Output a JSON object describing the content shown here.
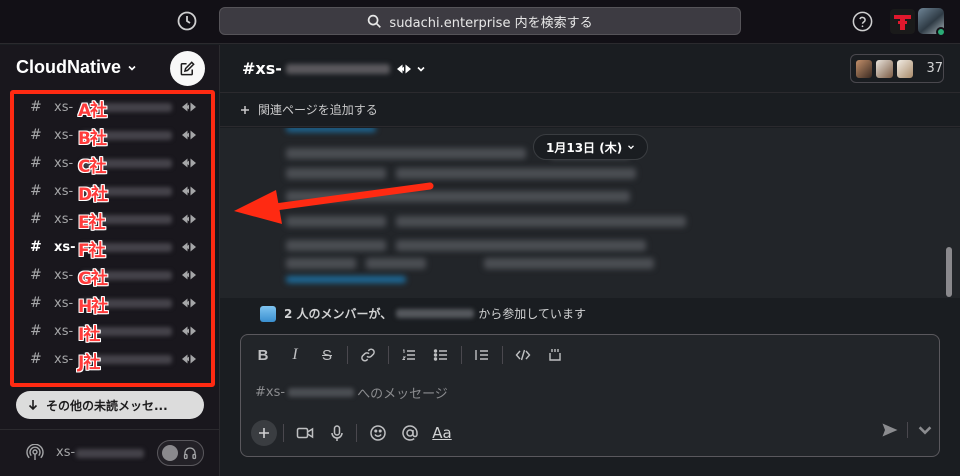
{
  "search": {
    "placeholder": "sudachi.enterprise 内を検索する"
  },
  "workspace": {
    "name": "CloudNative"
  },
  "sidebar": {
    "channels": [
      {
        "prefix": "xs-",
        "tag": "A社",
        "bold": false
      },
      {
        "prefix": "xs-",
        "tag": "B社",
        "bold": false
      },
      {
        "prefix": "xs-",
        "tag": "C社",
        "bold": false
      },
      {
        "prefix": "xs-",
        "tag": "D社",
        "bold": false
      },
      {
        "prefix": "xs-",
        "tag": "E社",
        "bold": false
      },
      {
        "prefix": "xs-",
        "tag": "F社",
        "bold": true
      },
      {
        "prefix": "xs-",
        "tag": "G社",
        "bold": false
      },
      {
        "prefix": "xs-",
        "tag": "H社",
        "bold": false
      },
      {
        "prefix": "xs-",
        "tag": "I社",
        "bold": false
      },
      {
        "prefix": "xs-",
        "tag": "J社",
        "bold": false
      }
    ],
    "unread_label": "その他の未読メッセ...",
    "huddle_prefix": "xs-"
  },
  "channel": {
    "hash": "#",
    "prefix": "xs-",
    "member_count": "37",
    "bookmark_label": "関連ページを追加する"
  },
  "messages": {
    "date_label": "1月13日 (木)"
  },
  "join": {
    "bold_text": "2 人のメンバーが、",
    "suffix": "から参加しています"
  },
  "composer": {
    "prefix": "#xs-",
    "suffix": "へのメッセージ",
    "aa_label": "Aa"
  },
  "colors": {
    "annotation_red": "#ff2a12",
    "tag_red": "#ff3b3b",
    "online_green": "#2bac76"
  }
}
